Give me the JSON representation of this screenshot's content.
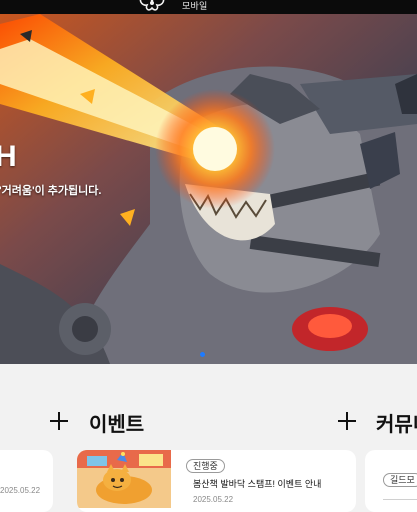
{
  "nav": {
    "label": "모바일"
  },
  "hero": {
    "title_partial": "H",
    "subtitle_partial": "'거려움'이 추가됩니다.",
    "active_dot_color": "#1e7bff"
  },
  "sections": {
    "left": {
      "date": "2025.05.22"
    },
    "events": {
      "title": "이벤트",
      "card": {
        "badge": "진행중",
        "title": "봄산책 발바닥 스탬프! 이벤트 안내",
        "date": "2025.05.22"
      }
    },
    "community": {
      "title": "커뮤니",
      "card": {
        "badge": "길드모"
      }
    }
  }
}
